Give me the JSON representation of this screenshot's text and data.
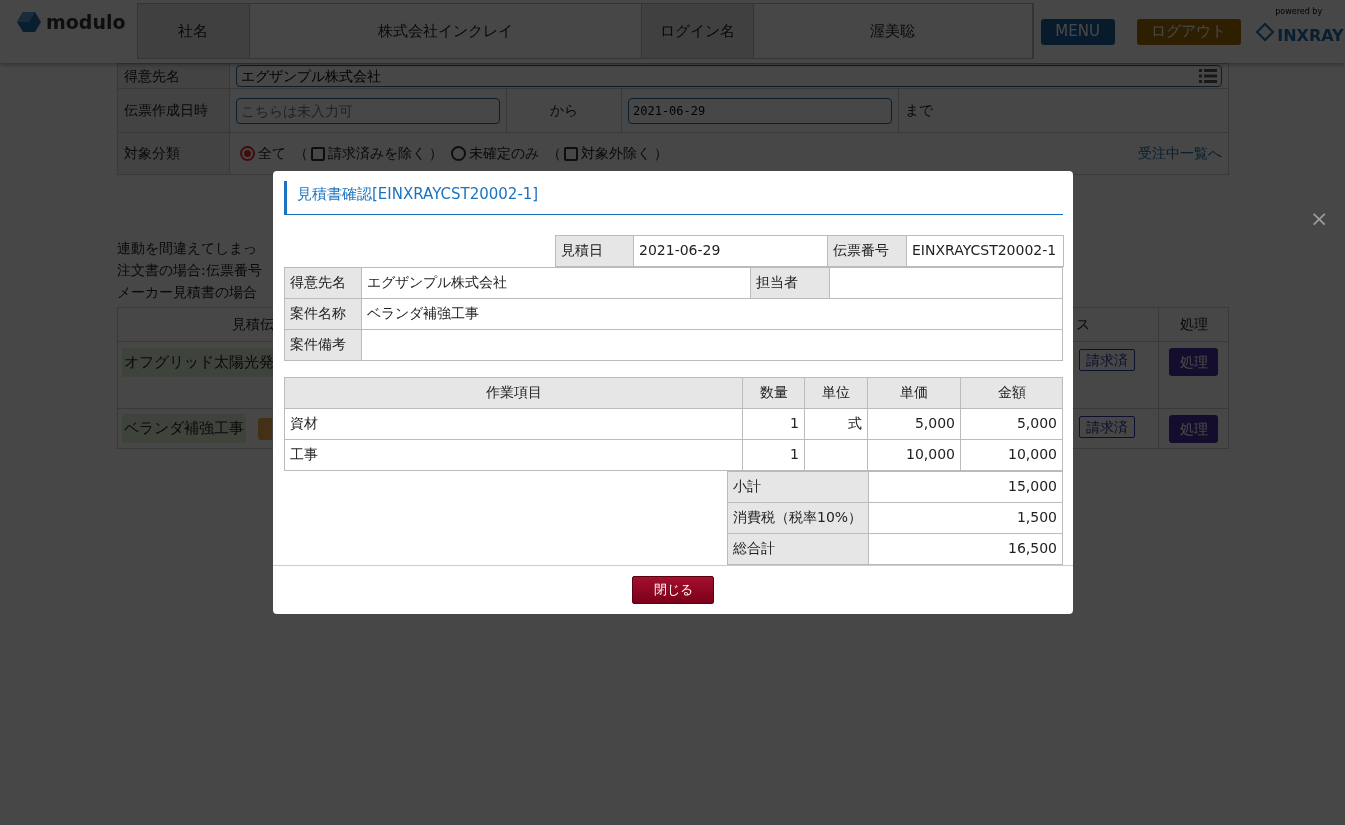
{
  "header": {
    "logo": "modulo",
    "company_label": "社名",
    "company": "株式会社インクレイ",
    "login_label": "ログイン名",
    "login": "渥美聡",
    "menu_button": "MENU",
    "logout_button": "ログアウト",
    "powered_by": "powered by",
    "brand": "INXRAY"
  },
  "form": {
    "customer": {
      "label": "得意先名",
      "value": "エグザンプル株式会社"
    },
    "date": {
      "label": "伝票作成日時",
      "from_placeholder": "こちらは未入力可",
      "from_word": "から",
      "to_value": "2021-06-29",
      "to_word": "まで"
    },
    "category": {
      "label": "対象分類",
      "options": [
        {
          "kind": "radio",
          "label": "全て",
          "checked": true
        },
        {
          "kind": "checkbox",
          "open": "（",
          "label": "請求済みを除く",
          "close": "）",
          "checked": false
        },
        {
          "kind": "radio",
          "label": "未確定のみ",
          "checked": false
        },
        {
          "kind": "checkbox",
          "open": "（",
          "label": "対象外除く",
          "close": "）",
          "checked": false
        }
      ],
      "link": "受注中一覧へ"
    }
  },
  "notes": [
    "連動を間違えてしまっ",
    "注文書の場合:伝票番号",
    "メーカー見積書の場合"
  ],
  "list": {
    "columns": [
      {
        "label": "見積伝"
      },
      {
        "label": "ス"
      },
      {
        "label": "処理"
      }
    ],
    "rows": [
      {
        "title": "オフグリッド太陽光発",
        "tagged": false,
        "status": "請求済",
        "action": "処理"
      },
      {
        "title": "ベランダ補強工事",
        "tagged": true,
        "status": "請求済",
        "action": "処理"
      }
    ]
  },
  "dismiss": "×",
  "modal": {
    "title": "見積書確認[EINXRAYCST20002-1]",
    "info": {
      "date_label": "見積日",
      "date": "2021-06-29",
      "number_label": "伝票番号",
      "number": "EINXRAYCST20002-1",
      "customer_label": "得意先名",
      "customer": "エグザンプル株式会社",
      "staff_label": "担当者",
      "project_label": "案件名称",
      "project": "ベランダ補強工事",
      "remarks_label": "案件備考"
    },
    "items": {
      "columns": [
        "作業項目",
        "数量",
        "単位",
        "単価",
        "金額"
      ],
      "rows": [
        {
          "name": "資材",
          "qty": "1",
          "unit": "式",
          "price": "5,000",
          "amount": "5,000"
        },
        {
          "name": "工事",
          "qty": "1",
          "price": "10,000",
          "amount": "10,000"
        }
      ]
    },
    "totals": [
      {
        "label": "小計",
        "value": "15,000"
      },
      {
        "label": "消費税（税率10%）",
        "value": "1,500"
      },
      {
        "label": "総合計",
        "value": "16,500"
      }
    ],
    "close_button": "閉じる"
  }
}
